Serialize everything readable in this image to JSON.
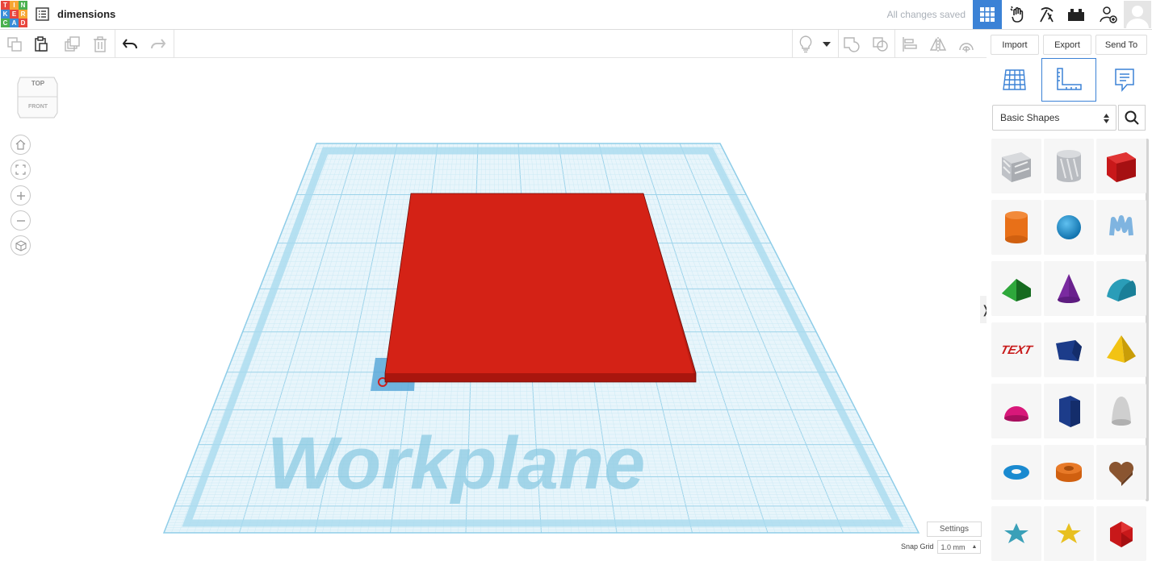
{
  "header": {
    "logo_letters": [
      "T",
      "I",
      "N",
      "K",
      "E",
      "R",
      "C",
      "A",
      "D"
    ],
    "title": "dimensions",
    "save_status": "All changes saved",
    "icons": [
      "grid-view-icon",
      "hand-icon",
      "pickaxe-icon",
      "brick-icon",
      "add-user-icon",
      "avatar-icon"
    ]
  },
  "toolbar": {
    "left_icons": [
      "copy-icon",
      "paste-icon",
      "duplicate-icon",
      "delete-icon",
      "undo-icon",
      "redo-icon"
    ],
    "right_icons": [
      "lightbulb-icon",
      "dropdown-caret-icon",
      "group-icon",
      "ungroup-icon",
      "align-icon",
      "mirror-icon",
      "cruise-icon"
    ],
    "import_label": "Import",
    "export_label": "Export",
    "sendto_label": "Send To"
  },
  "viewcube": {
    "top": "TOP",
    "front": "FRONT"
  },
  "nav": [
    "home-view-icon",
    "fit-view-icon",
    "zoom-in-icon",
    "zoom-out-icon",
    "perspective-icon"
  ],
  "workplane": {
    "label": "Workplane"
  },
  "panel": {
    "tabs": [
      "workplane-grid-tab",
      "ruler-tab",
      "notes-tab"
    ],
    "category": "Basic Shapes",
    "shapes": [
      "box-hole",
      "cylinder-hole",
      "box",
      "cylinder",
      "sphere",
      "scribble",
      "roof",
      "cone",
      "round-roof",
      "text",
      "shape-generator",
      "pyramid",
      "half-sphere",
      "polygon",
      "paraboloid",
      "torus",
      "tube",
      "heart",
      "star",
      "star-yellow",
      "icosahedron"
    ]
  },
  "footer": {
    "settings_label": "Settings",
    "snap_label": "Snap Grid",
    "snap_value": "1.0 mm"
  },
  "colors": {
    "accent": "#3b82d6",
    "box_red": "#d42216",
    "grid": "#bfe3f2"
  }
}
